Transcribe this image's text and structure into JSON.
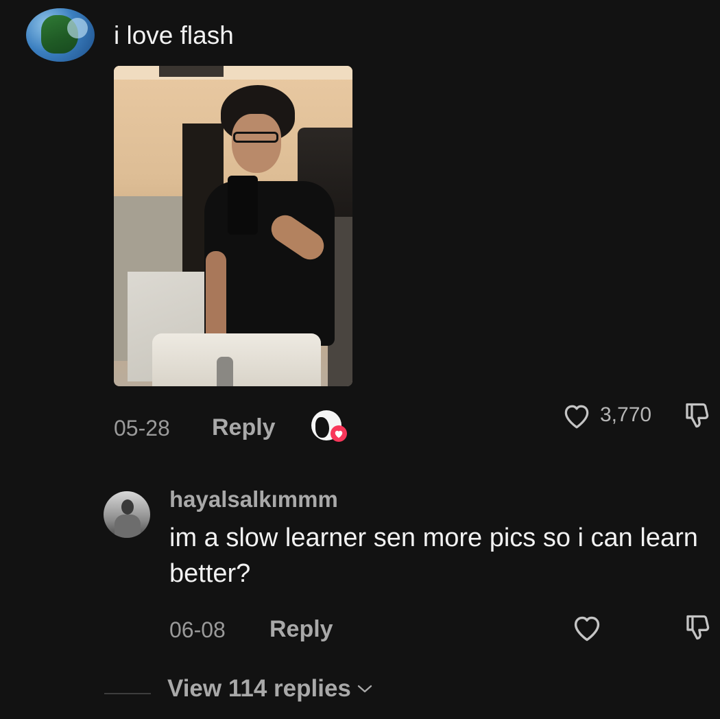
{
  "comment": {
    "text": "i love flash",
    "date": "05-28",
    "reply_label": "Reply",
    "like_count": "3,770"
  },
  "reply": {
    "username": "hayalsalkımmm",
    "text": "im a slow learner sen more pics so i can learn better?",
    "date": "06-08",
    "reply_label": "Reply"
  },
  "view_replies": {
    "label": "View 114 replies"
  },
  "icons": {
    "like": "heart-outline-icon",
    "dislike": "thumbs-down-outline-icon",
    "expand": "chevron-down-icon",
    "creator_liked": "creator-liked-heart-badge"
  },
  "colors": {
    "background": "#121212",
    "primary_text": "#f2f2f2",
    "secondary_text": "#a9a9a9",
    "creator_heart": "#f8375a"
  }
}
